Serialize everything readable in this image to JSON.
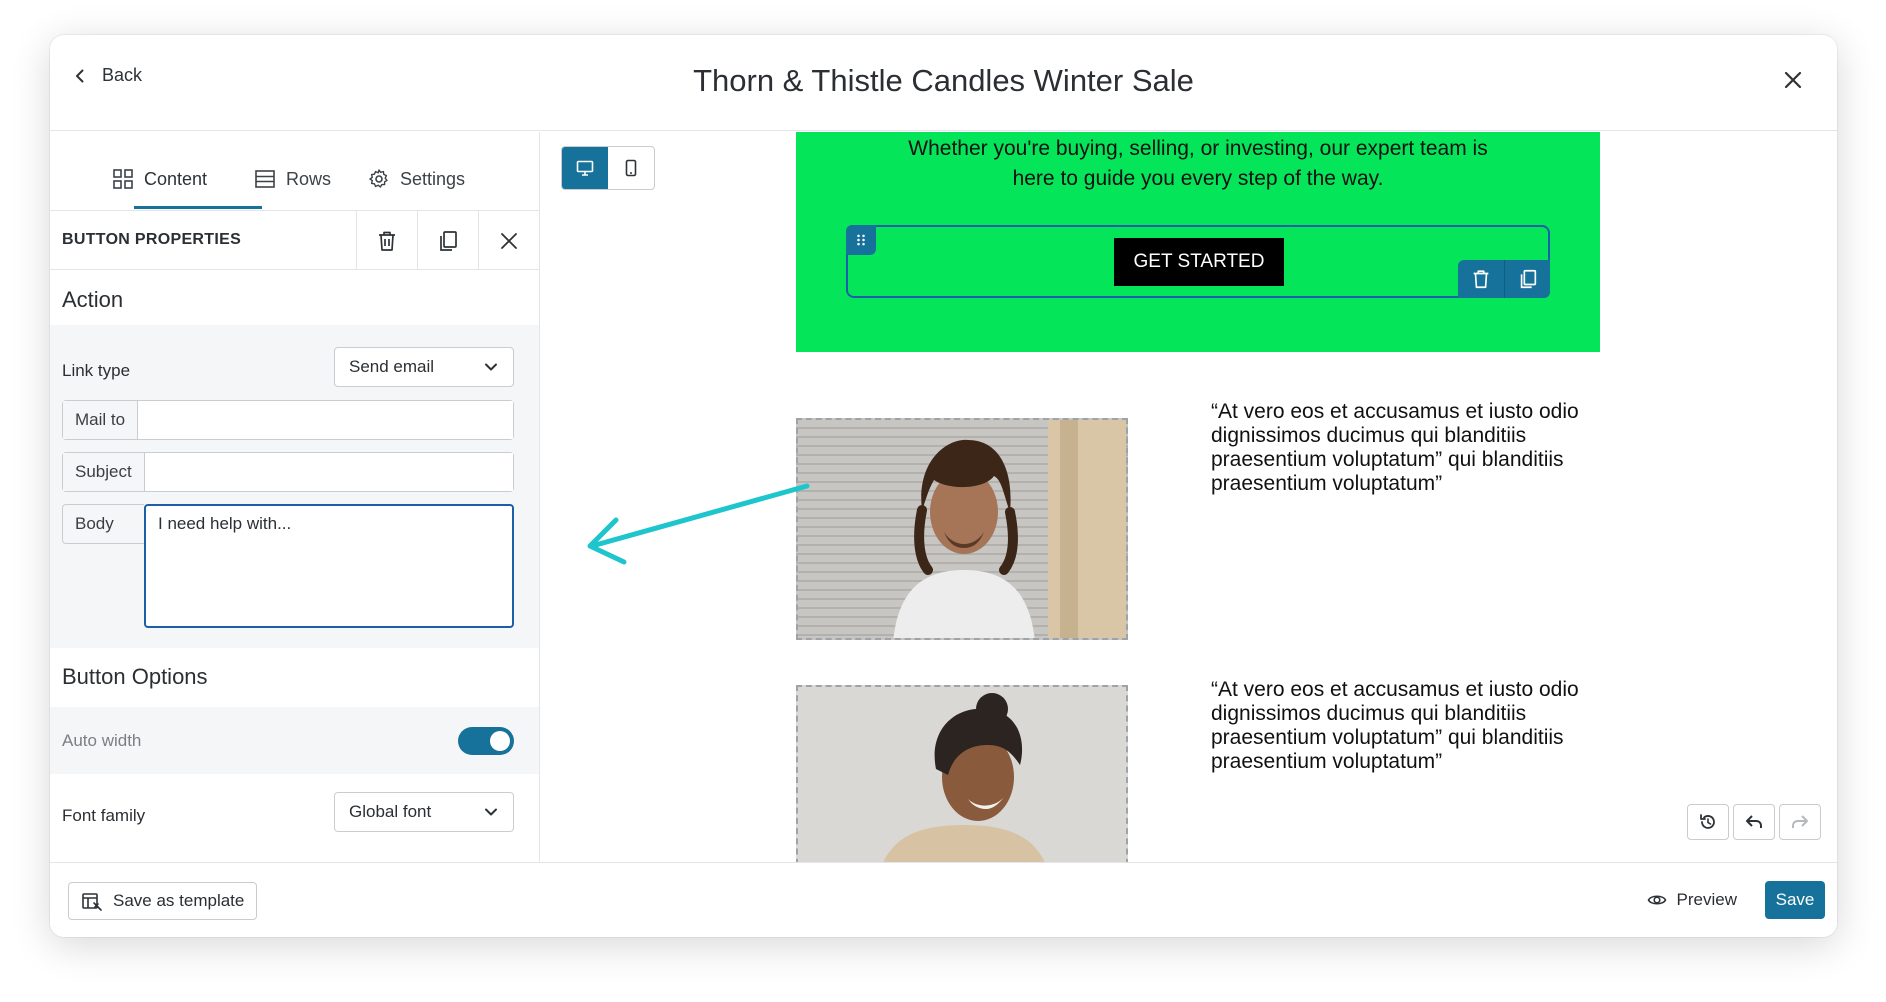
{
  "header": {
    "back_label": "Back",
    "title": "Thorn & Thistle Candles Winter Sale"
  },
  "tabs": [
    {
      "label": "Content",
      "icon": "grid-icon",
      "active": true
    },
    {
      "label": "Rows",
      "icon": "rows-icon",
      "active": false
    },
    {
      "label": "Settings",
      "icon": "gear-icon",
      "active": false
    }
  ],
  "properties": {
    "title": "BUTTON PROPERTIES"
  },
  "action": {
    "heading": "Action",
    "link_type_label": "Link type",
    "link_type_value": "Send email",
    "mail_to_label": "Mail to",
    "mail_to_value": "",
    "subject_label": "Subject",
    "subject_value": "",
    "body_label": "Body",
    "body_value": "I need help with..."
  },
  "button_options": {
    "heading": "Button Options",
    "auto_width_label": "Auto width",
    "auto_width_on": true,
    "font_family_label": "Font family",
    "font_family_value": "Global font"
  },
  "canvas": {
    "green_text": "Whether you're buying, selling, or investing, our expert team is here to guide you every step of the way.",
    "cta_label": "GET STARTED",
    "quotes": [
      "“At vero eos et accusamus et iusto odio dignissimos ducimus qui blanditiis praesentium voluptatum” qui blanditiis praesentium voluptatum”",
      "“At vero eos et accusamus et iusto odio dignissimos ducimus qui blanditiis praesentium voluptatum” qui blanditiis praesentium voluptatum”"
    ]
  },
  "footer": {
    "save_template_label": "Save as template",
    "preview_label": "Preview",
    "save_label": "Save"
  },
  "colors": {
    "accent": "#16729a",
    "green_block": "#04e55a",
    "focus": "#1c5fa8",
    "arrow": "#1fc5cc"
  }
}
